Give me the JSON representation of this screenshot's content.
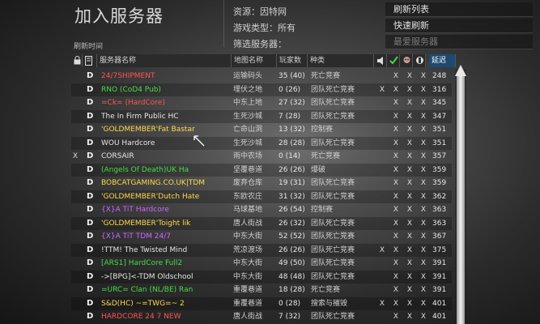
{
  "title": "加入服务器",
  "info": {
    "source_label": "资源：",
    "source_value": "因特网",
    "gametype_label": "游戏类型：",
    "gametype_value": "所有",
    "filter_label": "筛选服务器："
  },
  "buttons": {
    "refresh_list": "刷新列表",
    "quick_refresh": "快速刷新",
    "favorite": "最爱服务器"
  },
  "refresh_time_label": "刷新时间",
  "headers": {
    "name": "服务器名称",
    "map": "地图名称",
    "players": "玩家数",
    "gametype": "种类",
    "ping": "延迟"
  },
  "colors": {
    "sort_header": "#1d4a70"
  },
  "rows": [
    {
      "x": "",
      "d": "D",
      "name": "24/7SHIPMENT",
      "color": "#ff5555",
      "map": "运输码头",
      "players": "35 (40)",
      "gametype": "死亡竞赛",
      "k1": "",
      "k2": "X",
      "k3": "X",
      "k4": "X",
      "ping": "248"
    },
    {
      "x": "",
      "d": "D",
      "name": "RNO (CoD4 Pub)",
      "color": "#44dd44",
      "map": "埋伏之地",
      "players": "0 (26)",
      "gametype": "团队死亡竞赛",
      "k1": "X",
      "k2": "X",
      "k3": "X",
      "k4": "X",
      "ping": "316"
    },
    {
      "x": "",
      "d": "D",
      "name": "=Ck= (HardCore)",
      "color": "#ff5555",
      "map": "中东上地",
      "players": "27 (32)",
      "gametype": "团队死亡竞赛",
      "k1": "",
      "k2": "X",
      "k3": "X",
      "k4": "X",
      "ping": "345"
    },
    {
      "x": "",
      "d": "D",
      "name": "The In Firm Public HC",
      "color": "#e6e6e6",
      "map": "生死沙城",
      "players": "7 (28)",
      "gametype": "团队死亡竞赛",
      "k1": "",
      "k2": "X",
      "k3": "X",
      "k4": "X",
      "ping": "347"
    },
    {
      "x": "",
      "d": "D",
      "name": "'GOLDMEMBER'Fat Bastar",
      "color": "#ffd94a",
      "map": "亡命山洞",
      "players": "13 (32)",
      "gametype": "控制赛",
      "k1": "",
      "k2": "X",
      "k3": "X",
      "k4": "X",
      "ping": "351"
    },
    {
      "x": "",
      "d": "D",
      "name": "WOU Hardcore",
      "color": "#e6e6e6",
      "map": "生死沙城",
      "players": "28 (28)",
      "gametype": "团队死亡竞赛",
      "k1": "",
      "k2": "X",
      "k3": "X",
      "k4": "X",
      "ping": "351"
    },
    {
      "x": "X",
      "d": "D",
      "name": "CORSAIR",
      "color": "#e6e6e6",
      "map": "雨中农场",
      "players": "0 (14)",
      "gametype": "死亡竞赛",
      "k1": "",
      "k2": "X",
      "k3": "X",
      "k4": "X",
      "ping": "357"
    },
    {
      "x": "",
      "d": "D",
      "name": "(Angels Of Death)UK Ha",
      "color": "#44dd44",
      "map": "坚覆巷道",
      "players": "26 (26)",
      "gametype": "爆破",
      "k1": "",
      "k2": "X",
      "k3": "X",
      "k4": "X",
      "ping": "359"
    },
    {
      "x": "",
      "d": "D",
      "name": "BOBCATGAMING.CO.UK|TDM",
      "color": "#ffd94a",
      "map": "废弃仓库",
      "players": "19 (31)",
      "gametype": "团队死亡竞赛",
      "k1": "",
      "k2": "X",
      "k3": "X",
      "k4": "X",
      "ping": "359"
    },
    {
      "x": "",
      "d": "D",
      "name": "'GOLDMEMBER'Dutch Hate",
      "color": "#ffd94a",
      "map": "东欧农庄",
      "players": "31 (32)",
      "gametype": "团队死亡竞赛",
      "k1": "",
      "k2": "X",
      "k3": "X",
      "k4": "X",
      "ping": "362"
    },
    {
      "x": "",
      "d": "D",
      "name": "{X}A TiT Hardcore",
      "color": "#cc66ff",
      "map": "马球基地",
      "players": "26 (54)",
      "gametype": "控制赛",
      "k1": "",
      "k2": "X",
      "k3": "X",
      "k4": "X",
      "ping": "363"
    },
    {
      "x": "",
      "d": "D",
      "name": "'GOLDMEMBER'Toight lik",
      "color": "#ffd94a",
      "map": "唐人街战",
      "players": "26 (32)",
      "gametype": "团队死亡竞赛",
      "k1": "",
      "k2": "X",
      "k3": "X",
      "k4": "X",
      "ping": "363"
    },
    {
      "x": "",
      "d": "D",
      "name": "{X}A TiT TDM 24/7",
      "color": "#cc66ff",
      "map": "中东大街",
      "players": "52 (52)",
      "gametype": "团队死亡竞赛",
      "k1": "",
      "k2": "X",
      "k3": "X",
      "k4": "X",
      "ping": "367"
    },
    {
      "x": "",
      "d": "D",
      "name": "!TTM! The Twisted Mind",
      "color": "#e6e6e6",
      "map": "荒凉渡场",
      "players": "26 (26)",
      "gametype": "团队死亡竞赛",
      "k1": "X",
      "k2": "X",
      "k3": "X",
      "k4": "X",
      "ping": "375"
    },
    {
      "x": "",
      "d": "D",
      "name": "[ARS1] HardCore Full2",
      "color": "#44dd44",
      "map": "中东大街",
      "players": "49 (50)",
      "gametype": "团队死亡竞赛",
      "k1": "",
      "k2": "X",
      "k3": "X",
      "k4": "X",
      "ping": "391"
    },
    {
      "x": "",
      "d": "D",
      "name": "->[BPG]<-TDM Oldschool",
      "color": "#e6e6e6",
      "map": "中东大街",
      "players": "48 (48)",
      "gametype": "团队死亡竞赛",
      "k1": "",
      "k2": "X",
      "k3": "X",
      "k4": "X",
      "ping": "391"
    },
    {
      "x": "",
      "d": "D",
      "name": "=URC= Clan (NL/BE) Ran",
      "color": "#44dd44",
      "map": "重覆巷道",
      "players": "18 (28)",
      "gametype": "死亡竞赛",
      "k1": "",
      "k2": "X",
      "k3": "X",
      "k4": "X",
      "ping": "391"
    },
    {
      "x": "",
      "d": "D",
      "name": "S&D(HC) ~=TWG=~ 2",
      "color": "#ffd94a",
      "map": "重覆巷道",
      "players": "0 (28)",
      "gametype": "搜索与摧毁",
      "k1": "X",
      "k2": "X",
      "k3": "X",
      "k4": "X",
      "ping": "401"
    },
    {
      "x": "",
      "d": "D",
      "name": "HARDCORE 24 7 NEW",
      "color": "#ff5555",
      "map": "唐人街战",
      "players": "7 (32)",
      "gametype": "团队死亡竞赛",
      "k1": "",
      "k2": "X",
      "k3": "X",
      "k4": "X",
      "ping": "401"
    }
  ]
}
